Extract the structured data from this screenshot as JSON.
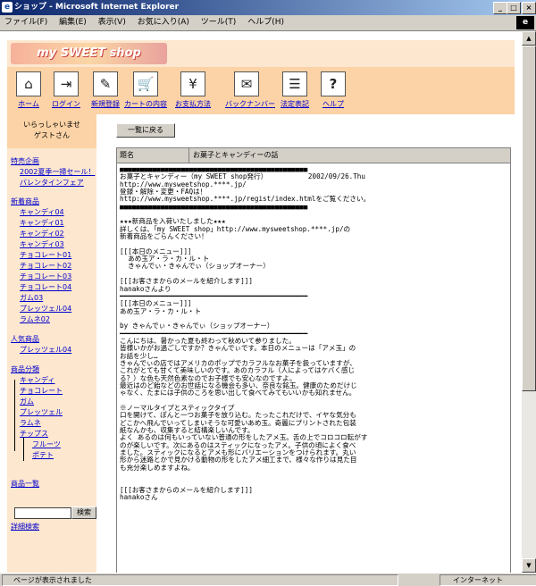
{
  "window": {
    "title": "ショップ - Microsoft Internet Explorer",
    "ie_icon": "e",
    "minimize": "_",
    "maximize": "□",
    "close": "×"
  },
  "menubar": [
    "ファイル(F)",
    "編集(E)",
    "表示(V)",
    "お気に入り(A)",
    "ツール(T)",
    "ヘルプ(H)"
  ],
  "brand": {
    "logo_text": "my SWEET shop"
  },
  "nav": [
    {
      "label": "ホーム",
      "icon": "house-icon",
      "glyph": "⌂"
    },
    {
      "label": "ログイン",
      "icon": "login-icon",
      "glyph": "⇥"
    },
    {
      "label": "新規登録",
      "icon": "register-icon",
      "glyph": "✎"
    },
    {
      "label": "カートの内容",
      "icon": "cart-icon",
      "glyph": "🛒"
    },
    {
      "label": "お支払方法",
      "icon": "payment-icon",
      "glyph": "¥"
    },
    {
      "label": "バックナンバー",
      "icon": "magazine-icon",
      "glyph": "✉"
    },
    {
      "label": "法定表記",
      "icon": "document-icon",
      "glyph": "☰"
    },
    {
      "label": "ヘルプ",
      "icon": "help-icon",
      "glyph": "?"
    }
  ],
  "welcome": {
    "line1": "いらっしゃいませ",
    "line2": "ゲストさん"
  },
  "sidebar": {
    "special": {
      "title": "特売企画",
      "items": [
        "2002夏季一掃セール！",
        "バレンタインフェア"
      ]
    },
    "new": {
      "title": "新着商品",
      "items": [
        "キャンディ04",
        "キャンディ01",
        "キャンディ02",
        "キャンディ03",
        "チョコレート01",
        "チョコレート02",
        "チョコレート03",
        "チョコレート04",
        "ガム03",
        "プレッツェル04",
        "ラムネ02"
      ]
    },
    "popular": {
      "title": "人気商品",
      "items": [
        "プレッツェル04"
      ]
    },
    "category": {
      "title": "商品分類",
      "items": [
        "キャンディ",
        "チョコレート",
        "ガム",
        "プレッツェル",
        "ラムネ",
        "チップス"
      ],
      "sub": [
        "フルーツ",
        "ポテト"
      ]
    },
    "list_link": "商品一覧",
    "search_button": "検索",
    "advanced_search": "詳細検索"
  },
  "back_button": "一覧に戻る",
  "mail": {
    "header_key": "題名",
    "header_value": "お菓子とキャンディーの話",
    "lines": [
      "■■■■■■■■■■■■■■■■■■■■■■■■■■■■■■■■■■■■■■■■■■■■■■",
      "お菓子とキャンディー（my SWEET shop発行）          2002/09/26.Thu",
      "http://www.mysweetshop.****.jp/",
      "登録・解除・変更・FAQは！",
      "http://www.mysweetshop.****.jp/regist/index.htmlをご覧ください。",
      "■■■■■■■■■■■■■■■■■■■■■■■■■■■■■■■■■■■■■■■■■■■■■■",
      "",
      "★★★新商品を入荷いたしました★★★",
      "詳しくは、「my SWEET shop」http://www.mysweetshop.****.jp/の",
      "新着商品をごらんください！",
      "",
      "[[[本日のメニュー]]]",
      "  あめ玉ア・ラ・カ・ル・ト",
      "  きゃんでぃ・きゃんでぃ（ショップオーナー）",
      "",
      "[[[お客さまからのメールを紹介します]]]",
      "hanakoさんより",
      "━━━━━━━━━━━━━━━━━━━━━━━━━━━━━━━━━━━━━━━━━━━━━━",
      "[[[本日のメニュー]]]",
      "あめ玉ア・ラ・カ・ル・ト",
      "",
      "by きゃんでぃ・きゃんでぃ（ショップオーナー）",
      "━━━━━━━━━━━━━━━━━━━━━━━━━━━━━━━━━━━━━━━━━━━━━━",
      "こんにちは、暑かった夏も終わって秋めいて参りました。",
      "皆様いかがお過ごしですか？きゃんでぃです。本日のメニューは「アメ玉」の",
      "お話を少し…",
      "きゃんでぃの店ではアメリカのポップでカラフルなお菓子を扱っていますが、",
      "これがとても甘くて美味しいのです。あのカラフル（人によってはケバく感じ",
      "る？）な色も天然色素なのでお子様でも安心なのですよ。",
      "最近はのど飴などのお世話になる機会も多い、奈良な銘玉。健康のためだけじ",
      "ゃなく、たまには子供のころを思い出して食べてみてもいいかも知れません。",
      "",
      "※ノーマルタイプとスティックタイプ",
      "口を開けて、ぽんと一つお菓子を放り込む。たったこれだけで、イヤな気分も",
      "どこかへ飛んでいってしまいそうな可愛いあめ玉。奇麗にプリントされた包装",
      "紙なんかも、収集すると結構楽しいんです。",
      "よく あるのは何もいっていない普通の形をしたアメ玉。舌の上でコロコロ転がす",
      "のが楽しいです。次にあるのはスティックになったアメ。子供の頃によく食べ",
      "ました。スティックになるとアメも形にバリエーションをつけられます。丸い",
      "形から迷路とかで見かける動物の形をしたアメ細工まで、様々な作りは見た目",
      "も充分楽しめますよね。",
      "",
      "",
      "[[[お客さまからのメールを紹介します]]]",
      "hanakoさん"
    ]
  },
  "status": {
    "left": "ページが表示されました",
    "right": "インターネット"
  }
}
